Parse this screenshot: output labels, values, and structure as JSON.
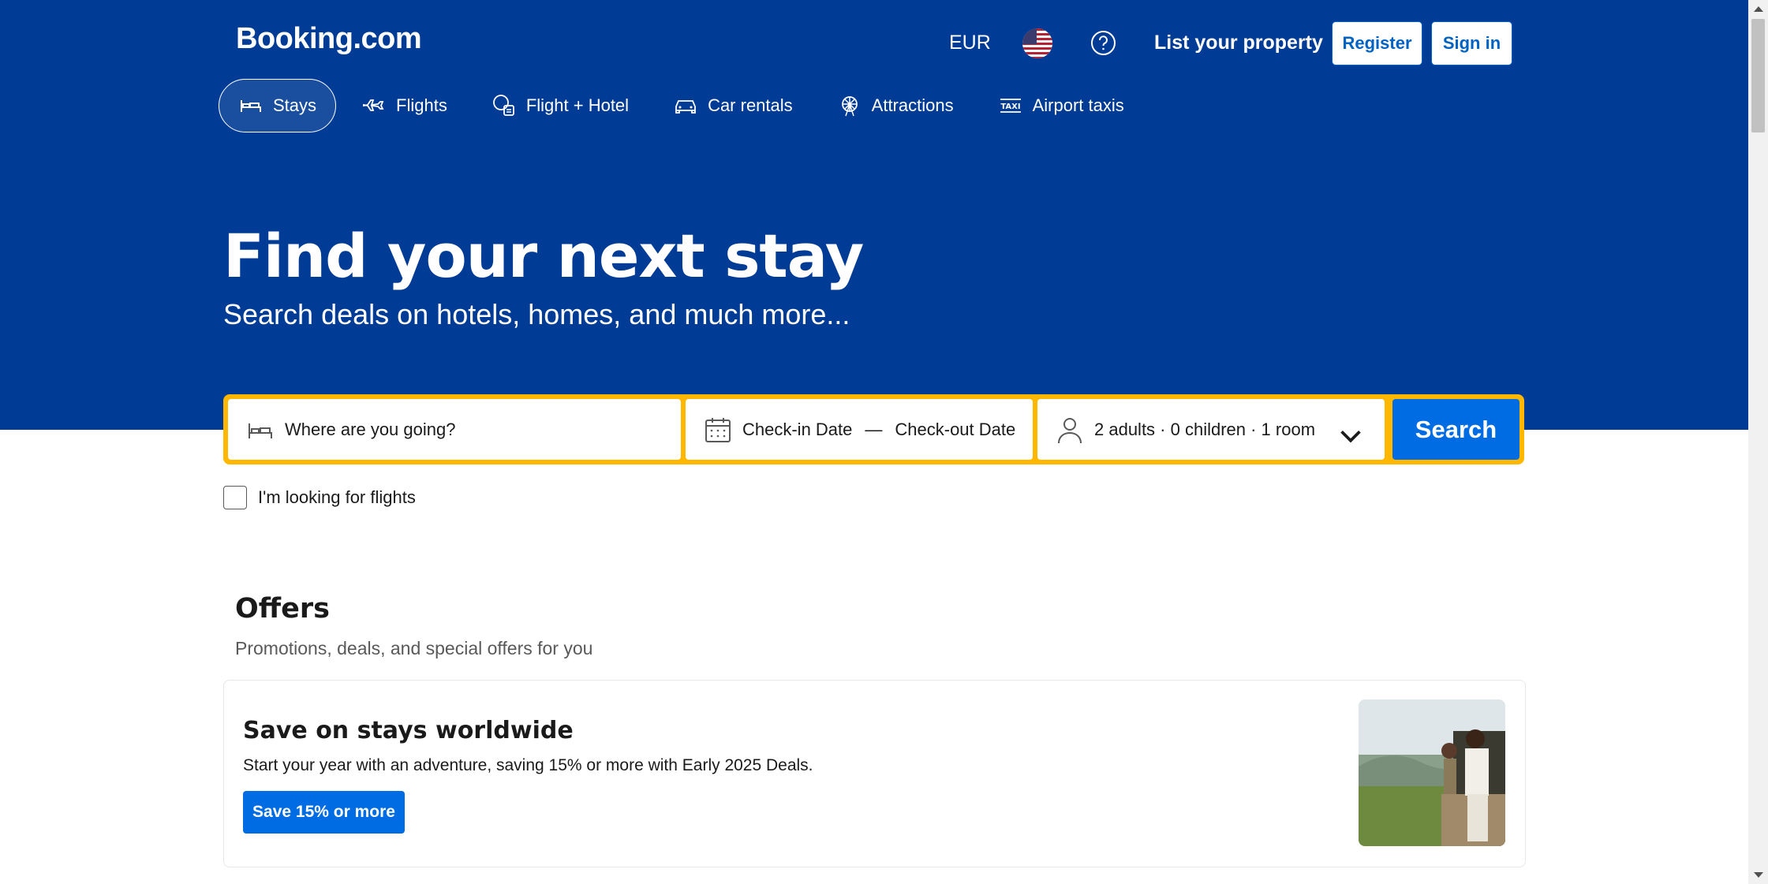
{
  "brand": {
    "logo": "Booking.com",
    "color_primary": "#003b95",
    "color_accent": "#006ce4",
    "color_highlight": "#ffb700"
  },
  "header": {
    "currency": "EUR",
    "language_flag": "us-flag-icon",
    "help_icon": "question-circle-icon",
    "list_property": "List your property",
    "register": "Register",
    "sign_in": "Sign in"
  },
  "nav": {
    "items": [
      {
        "label": "Stays",
        "icon": "bed-icon",
        "active": true
      },
      {
        "label": "Flights",
        "icon": "plane-icon"
      },
      {
        "label": "Flight + Hotel",
        "icon": "flight-hotel-icon"
      },
      {
        "label": "Car rentals",
        "icon": "car-icon"
      },
      {
        "label": "Attractions",
        "icon": "ferris-wheel-icon"
      },
      {
        "label": "Airport taxis",
        "icon": "taxi-icon"
      }
    ]
  },
  "hero": {
    "title": "Find your next stay",
    "subtitle": "Search deals on hotels, homes, and much more..."
  },
  "search": {
    "destination_placeholder": "Where are you going?",
    "checkin": "Check-in Date",
    "separator": "—",
    "checkout": "Check-out Date",
    "guests": "2 adults · 0 children · 1 room",
    "button": "Search",
    "flights_checkbox": "I'm looking for flights"
  },
  "offers": {
    "title": "Offers",
    "subtitle": "Promotions, deals, and special offers for you",
    "card": {
      "title": "Save on stays worldwide",
      "description": "Start your year with an adventure, saving 15% or more with Early 2025 Deals.",
      "button": "Save 15% or more"
    }
  }
}
